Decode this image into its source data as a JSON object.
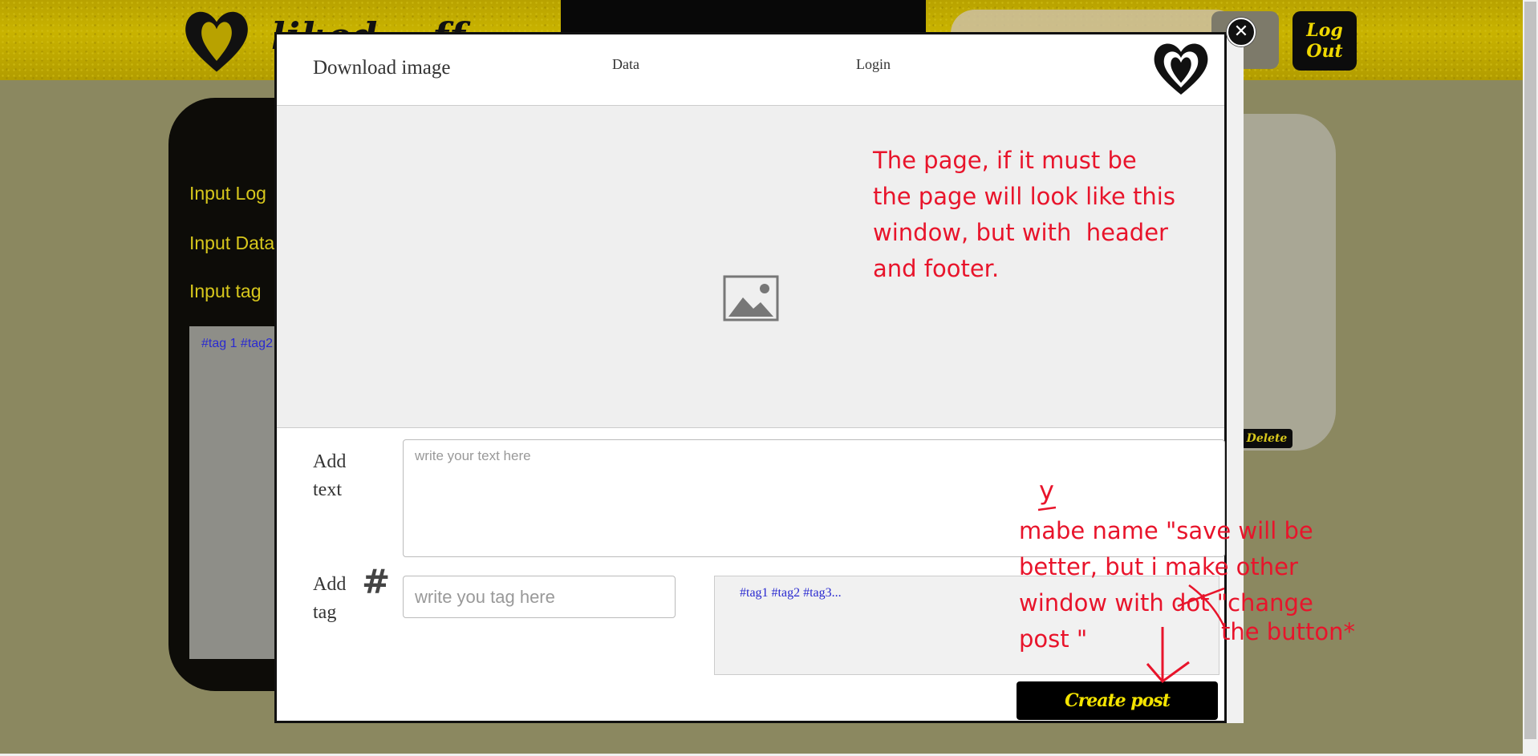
{
  "background": {
    "logo_text": "liked... ff",
    "logout_label": "Log Out",
    "sidebar_labels": [
      "Input Log",
      "Input Data",
      "Input tag"
    ],
    "tags_text": "#tag 1 #tag2",
    "delete_label": "Delete"
  },
  "modal": {
    "close_icon": "✕",
    "header": {
      "title": "Download image",
      "nav_data": "Data",
      "nav_login": "Login"
    },
    "image_placeholder_icon": "image-icon",
    "add_text_label": "Add\ntext",
    "text_placeholder": "write your text here",
    "add_tag_label": "Add\ntag",
    "hash_symbol": "#",
    "tag_placeholder": "write you tag here",
    "tags_preview": "#tag1 #tag2 #tag3...",
    "create_button": "Create post"
  },
  "annotations": {
    "note_page": "The page, if it must be\nthe page will look like this\nwindow, but with  header\nand footer.",
    "note_button": "mabe name \"save will be\nbetter, but i make other\nwindow with dot \"change\npost \"",
    "note_button_tail": "the button*",
    "note_y": "y"
  },
  "colors": {
    "annotation": "#e8142b",
    "accent_yellow": "#f4e400",
    "tag_blue": "#2a2ad0"
  }
}
